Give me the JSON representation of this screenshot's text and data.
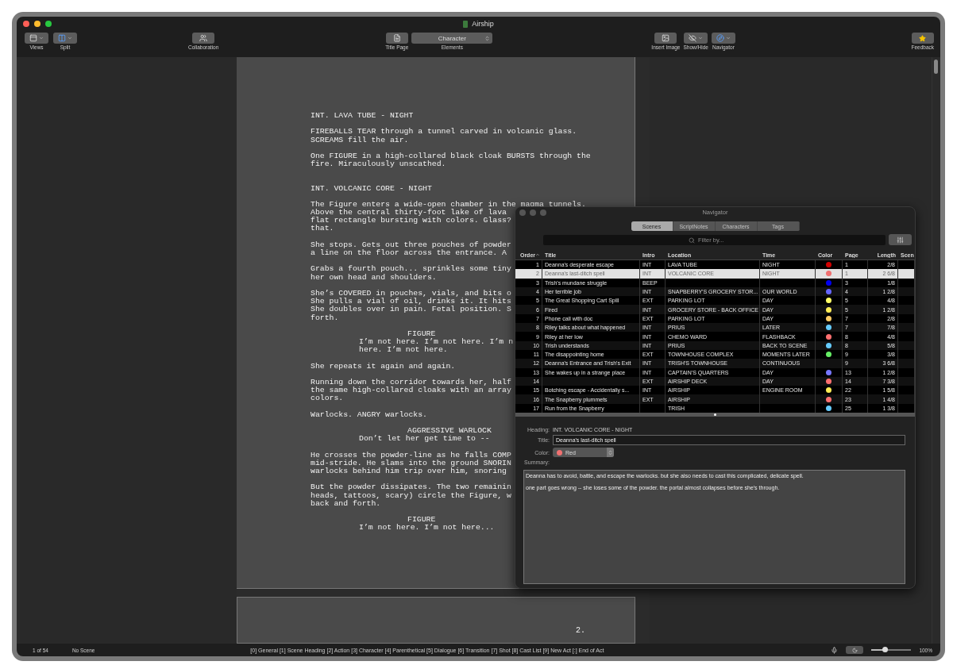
{
  "window": {
    "title": "Airship"
  },
  "toolbar": {
    "left": [
      {
        "kind": "views",
        "label": "Views"
      },
      {
        "kind": "split",
        "label": "Split"
      }
    ],
    "collaboration": {
      "label": "Collaboration"
    },
    "center": {
      "title_page": "Title Page",
      "elements_value": "Character",
      "elements_label": "Elements"
    },
    "right": [
      {
        "kind": "image",
        "label": "Insert Image"
      },
      {
        "kind": "showhide",
        "label": "Show/Hide"
      },
      {
        "kind": "navigator",
        "label": "Navigator"
      }
    ],
    "feedback": {
      "label": "Feedback"
    }
  },
  "script": {
    "blocks": [
      {
        "kind": "heading",
        "lines": [
          "INT. LAVA TUBE - NIGHT"
        ]
      },
      {
        "kind": "action",
        "lines": [
          "FIREBALLS TEAR through a tunnel carved in volcanic glass.",
          "SCREAMS fill the air."
        ]
      },
      {
        "kind": "action",
        "lines": [
          "One FIGURE in a high-collared black cloak BURSTS through the",
          "fire. Miraculously unscathed."
        ]
      },
      {
        "kind": "heading",
        "lines": [
          "INT. VOLCANIC CORE - NIGHT"
        ]
      },
      {
        "kind": "action",
        "lines": [
          "The Figure enters a wide-open chamber in the magma tunnels.",
          "Above the central thirty-foot lake of lava",
          "flat rectangle bursting with colors. Glass?",
          "that."
        ]
      },
      {
        "kind": "action",
        "lines": [
          "She stops. Gets out three pouches of powder",
          "a line on the floor across the entrance. A"
        ]
      },
      {
        "kind": "action",
        "lines": [
          "Grabs a fourth pouch... sprinkles some tiny",
          "her own head and shoulders."
        ]
      },
      {
        "kind": "action",
        "lines": [
          "She’s COVERED in pouches, vials, and bits o",
          "She pulls a vial of oil, drinks it. It hits",
          "She doubles over in pain. Fetal position. S",
          "forth."
        ]
      },
      {
        "kind": "character",
        "lines": [
          "FIGURE"
        ]
      },
      {
        "kind": "dialogue",
        "lines": [
          "I’m not here. I’m not here. I’m n",
          "here. I’m not here."
        ]
      },
      {
        "kind": "action",
        "lines": [
          "She repeats it again and again."
        ]
      },
      {
        "kind": "action",
        "lines": [
          "Running down the corridor towards her, half",
          "the same high-collared cloaks with an array",
          "colors."
        ]
      },
      {
        "kind": "action",
        "lines": [
          "Warlocks. ANGRY warlocks."
        ]
      },
      {
        "kind": "character",
        "lines": [
          "AGGRESSIVE WARLOCK"
        ]
      },
      {
        "kind": "dialogue",
        "lines": [
          "Don’t let her get time to --"
        ]
      },
      {
        "kind": "action",
        "lines": [
          "He crosses the powder-line as he falls COMP",
          "mid-stride. He slams into the ground SNORIN",
          "warlocks behind him trip over him, snoring"
        ]
      },
      {
        "kind": "action",
        "lines": [
          "But the powder dissipates. The two remainin",
          "heads, tattoos, scary) circle the Figure, w",
          "back and forth."
        ]
      },
      {
        "kind": "character",
        "lines": [
          "FIGURE"
        ]
      },
      {
        "kind": "dialogue",
        "lines": [
          "I’m not here. I’m not here..."
        ]
      }
    ],
    "next_page_number": "2."
  },
  "navigator": {
    "title": "Navigator",
    "tabs": [
      {
        "label": "Scenes",
        "selected": true
      },
      {
        "label": "ScriptNotes",
        "selected": false
      },
      {
        "label": "Characters",
        "selected": false
      },
      {
        "label": "Tags",
        "selected": false
      }
    ],
    "filter": {
      "placeholder": "Filter by..."
    },
    "columns": [
      "Order",
      "Title",
      "Intro",
      "Location",
      "Time",
      "Color",
      "Page",
      "Length",
      "Scen"
    ],
    "rows": [
      {
        "order": "1",
        "title": "Deanna's desperate escape",
        "intro": "INT",
        "location": "LAVA TUBE",
        "time": "NIGHT",
        "color": "#d00000",
        "page": "1",
        "length": "2/8",
        "selected": false
      },
      {
        "order": "2",
        "title": "Deanna's last-ditch spell",
        "intro": "INT",
        "location": "VOLCANIC CORE",
        "time": "NIGHT",
        "color": "#f07070",
        "page": "1",
        "length": "2 6/8",
        "selected": true
      },
      {
        "order": "3",
        "title": "Trish's mundane struggle",
        "intro": "BEEP",
        "location": "",
        "time": "",
        "color": "#0000f0",
        "page": "3",
        "length": "1/8",
        "selected": false
      },
      {
        "order": "4",
        "title": "Her terrible job",
        "intro": "INT",
        "location": "SNAPBERRY'S GROCERY STOR...",
        "time": "OUR WORLD",
        "color": "#6666ff",
        "page": "4",
        "length": "1 2/8",
        "selected": false
      },
      {
        "order": "5",
        "title": "The Great Shopping Cart Spill",
        "intro": "EXT",
        "location": "PARKING LOT",
        "time": "DAY",
        "color": "#ffff66",
        "page": "5",
        "length": "4/8",
        "selected": false
      },
      {
        "order": "6",
        "title": "Fired",
        "intro": "INT",
        "location": "GROCERY STORE - BACK OFFICE",
        "time": "DAY",
        "color": "#ffee55",
        "page": "5",
        "length": "1 2/8",
        "selected": false
      },
      {
        "order": "7",
        "title": "Phone call with doc",
        "intro": "EXT",
        "location": "PARKING LOT",
        "time": "DAY",
        "color": "#ffcc66",
        "page": "7",
        "length": "2/8",
        "selected": false
      },
      {
        "order": "8",
        "title": "Riley talks about what happened",
        "intro": "INT",
        "location": "PRIUS",
        "time": "LATER",
        "color": "#66ccff",
        "page": "7",
        "length": "7/8",
        "selected": false
      },
      {
        "order": "9",
        "title": "Riley at her low",
        "intro": "INT",
        "location": "CHEMO WARD",
        "time": "FLASHBACK",
        "color": "#ff7070",
        "page": "8",
        "length": "4/8",
        "selected": false
      },
      {
        "order": "10",
        "title": "Trish understands",
        "intro": "INT",
        "location": "PRIUS",
        "time": "BACK TO SCENE",
        "color": "#66ccff",
        "page": "8",
        "length": "5/8",
        "selected": false
      },
      {
        "order": "11",
        "title": "The disappointing home",
        "intro": "EXT",
        "location": "TOWNHOUSE COMPLEX",
        "time": "MOMENTS LATER",
        "color": "#66ee66",
        "page": "9",
        "length": "3/8",
        "selected": false
      },
      {
        "order": "12",
        "title": "Deanna's Entrance and Trish's Exit",
        "intro": "INT",
        "location": "TRISH'S TOWNHOUSE",
        "time": "CONTINUOUS",
        "page": "9",
        "length": "3 6/8",
        "selected": false
      },
      {
        "order": "13",
        "title": "She wakes up in a strange place",
        "intro": "INT",
        "location": "CAPTAIN'S QUARTERS",
        "time": "DAY",
        "color": "#7777ff",
        "page": "13",
        "length": "1 2/8",
        "selected": false
      },
      {
        "order": "14",
        "title": "",
        "intro": "EXT",
        "location": "AIRSHIP DECK",
        "time": "DAY",
        "color": "#ff7070",
        "page": "14",
        "length": "7 3/8",
        "selected": false
      },
      {
        "order": "15",
        "title": "Botching escape - Accidentally s...",
        "intro": "INT",
        "location": "AIRSHIP",
        "time": "ENGINE ROOM",
        "color": "#ffee55",
        "page": "22",
        "length": "1 5/8",
        "selected": false
      },
      {
        "order": "16",
        "title": "The Snapberry plummets",
        "intro": "EXT",
        "location": "AIRSHIP",
        "time": "",
        "color": "#ff7070",
        "page": "23",
        "length": "1 4/8",
        "selected": false
      },
      {
        "order": "17",
        "title": "Run from the Snapberry",
        "intro": "",
        "location": "TRISH",
        "time": "",
        "color": "#66ccff",
        "page": "25",
        "length": "1 3/8",
        "selected": false
      }
    ],
    "details": {
      "heading_label": "Heading:",
      "heading": "INT. VOLCANIC CORE - NIGHT",
      "title_label": "Title:",
      "title": "Deanna's last-ditch spell",
      "color_label": "Color:",
      "color_name": "Red",
      "color": "#f07070",
      "summary_label": "Summary:",
      "summary": [
        "Deanna has to avoid, battle, and escape the warlocks. but she also needs to cast this complicated, delicate spell.",
        "one part goes wrong -- she loses some of the powder. the portal almost collapses before she's through."
      ]
    }
  },
  "status_bar": {
    "page": "1 of 54",
    "scene": "No Scene",
    "shortcuts": "[0] General [1] Scene Heading [2] Action [3] Character [4] Parenthetical [5] Dialogue [6] Transition [7] Shot [8] Cast List [9] New Act [:] End of Act",
    "zoom": {
      "level": 0.35
    },
    "zoom_text": "100%"
  }
}
